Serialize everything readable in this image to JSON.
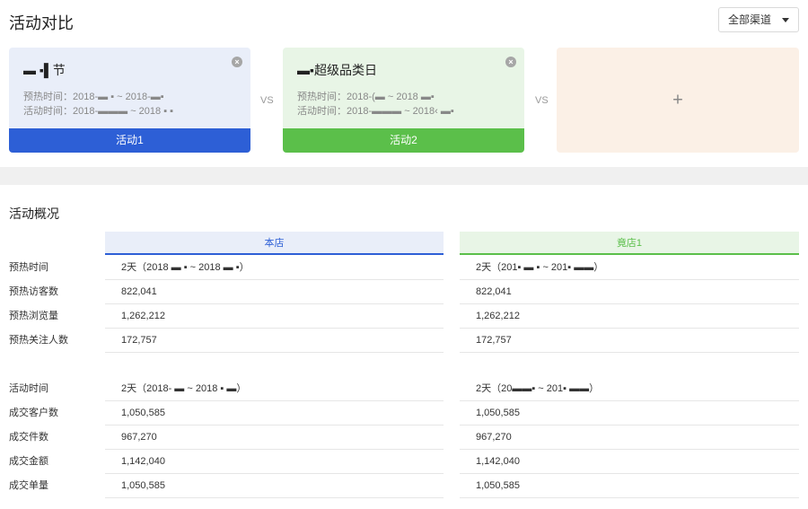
{
  "header": {
    "title": "活动对比",
    "channel": "全部渠道"
  },
  "cards": [
    {
      "name": "▬  ▪▌节",
      "preheat": "预热时间：2018-▬ ▪ ~ 2018-▬▪",
      "activity": "活动时间：2018-▬▬▬ ~ 2018 ▪ ▪",
      "footer": "活动1"
    },
    {
      "name": "▬▪超级品类日",
      "preheat": "预热时间：2018-(▬ ~ 2018 ▬▪",
      "activity": "活动时间：2018-▬▬▬ ~ 2018‹ ▬▪",
      "footer": "活动2"
    }
  ],
  "vs_label": "VS",
  "add_card": {
    "icon": "+"
  },
  "overview": {
    "title": "活动概况",
    "columns": [
      "本店",
      "竟店1"
    ],
    "rows": [
      {
        "label": "预热时间",
        "a": "2天（2018 ▬ ▪ ~ 2018 ▬ ▪）",
        "b": "2天（201▪ ▬ ▪ ~ 201▪ ▬▬）"
      },
      {
        "label": "预热访客数",
        "a": "822,041",
        "b": "822,041"
      },
      {
        "label": "预热浏览量",
        "a": "1,262,212",
        "b": "1,262,212"
      },
      {
        "label": "预热关注人数",
        "a": "172,757",
        "b": "172,757"
      },
      {
        "label": "活动时间",
        "a": "2天（2018- ▬ ~ 2018 ▪ ▬）",
        "b": "2天（20▬▬▪ ~ 201▪ ▬▬）"
      },
      {
        "label": "成交客户数",
        "a": "1,050,585",
        "b": "1,050,585"
      },
      {
        "label": "成交件数",
        "a": "967,270",
        "b": "967,270"
      },
      {
        "label": "成交金额",
        "a": "1,142,040",
        "b": "1,142,040"
      },
      {
        "label": "成交单量",
        "a": "1,050,585",
        "b": "1,050,585"
      }
    ]
  },
  "colors": {
    "blue": "#2d5fd6",
    "green": "#5bbf4a",
    "card_blue_bg": "#e9eef9",
    "card_green_bg": "#e8f5e6",
    "card_orange_bg": "#fbf0e6"
  }
}
